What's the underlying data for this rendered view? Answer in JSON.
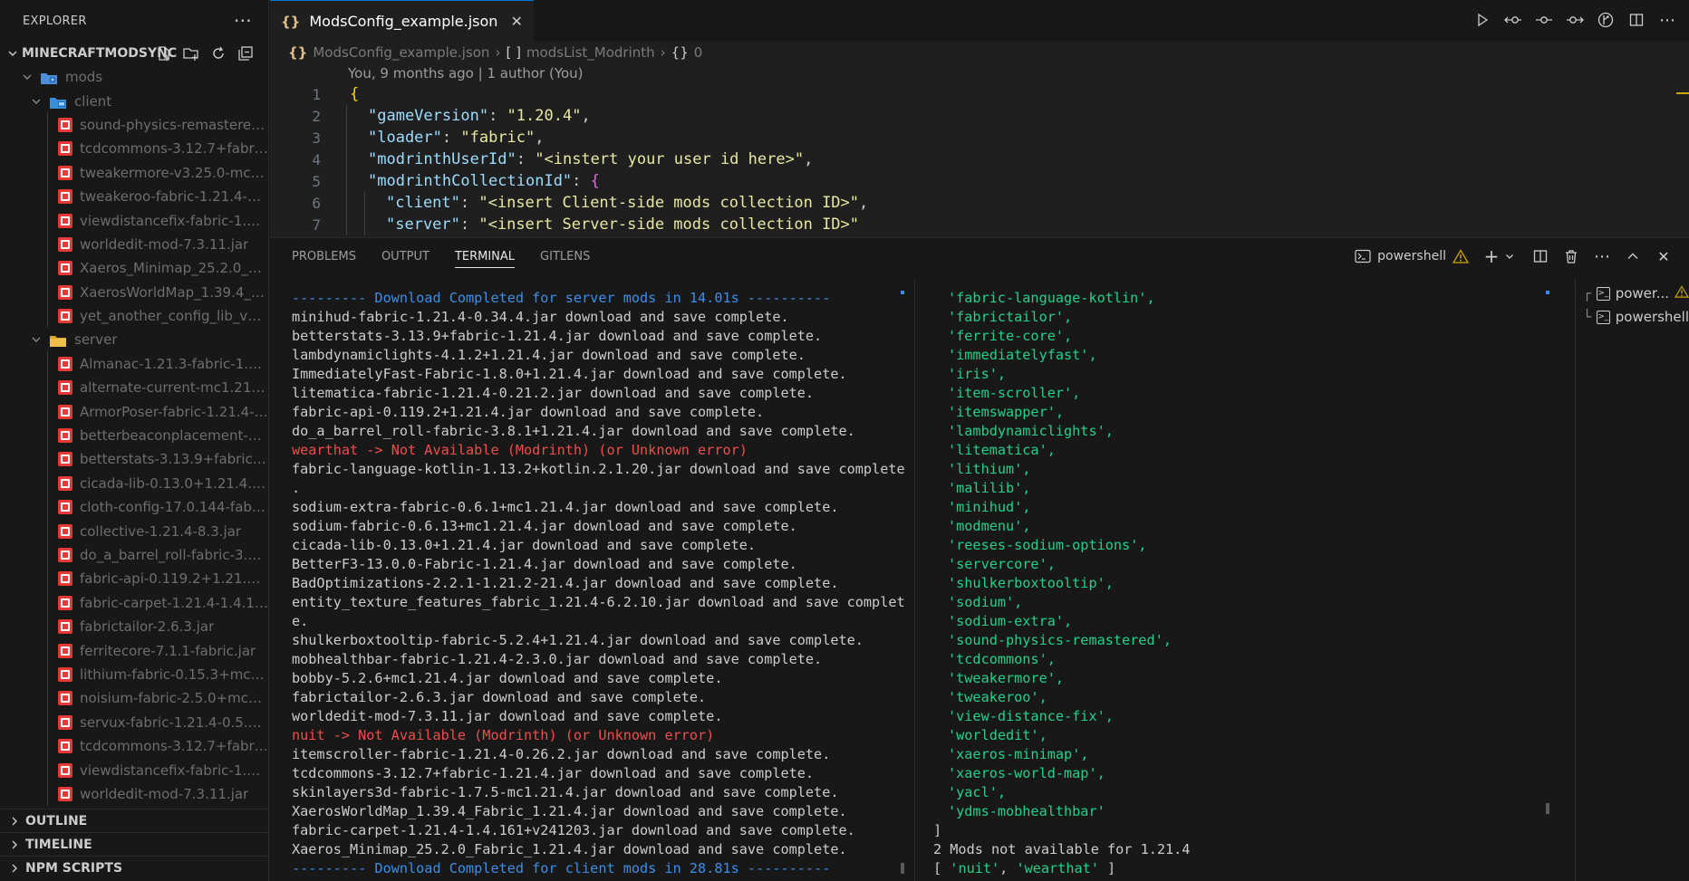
{
  "sidebar": {
    "title": "EXPLORER",
    "root": "MINECRAFTMODSYNC",
    "folder_mods": "mods",
    "folder_client": "client",
    "client_files": [
      "sound-physics-remastered-f...",
      "tcdcommons-3.12.7+fabric-...",
      "tweakermore-v3.25.0-mc1.2...",
      "tweakeroo-fabric-1.21.4-0.2...",
      "viewdistancefix-fabric-1.21.4...",
      "worldedit-mod-7.3.11.jar",
      "Xaeros_Minimap_25.2.0_Fabr...",
      "XaerosWorldMap_1.39.4_Fab...",
      "yet_another_config_lib_v3-3...."
    ],
    "folder_server": "server",
    "server_files": [
      "Almanac-1.21.3-fabric-1.4.4.j...",
      "alternate-current-mc1.21.2-...",
      "ArmorPoser-fabric-1.21.4-8....",
      "betterbeaconplacement-1.2...",
      "betterstats-3.13.9+fabric-1.2...",
      "cicada-lib-0.13.0+1.21.4.jar",
      "cloth-config-17.0.144-fabric...",
      "collective-1.21.4-8.3.jar",
      "do_a_barrel_roll-fabric-3.8.1...",
      "fabric-api-0.119.2+1.21.4.jar",
      "fabric-carpet-1.21.4-1.4.161....",
      "fabrictailor-2.6.3.jar",
      "ferritecore-7.1.1-fabric.jar",
      "lithium-fabric-0.15.3+mc1.2...",
      "noisium-fabric-2.5.0+mc1.21....",
      "servux-fabric-1.21.4-0.5.2.jar",
      "tcdcommons-3.12.7+fabric-...",
      "viewdistancefix-fabric-1.21.4...",
      "worldedit-mod-7.3.11.jar"
    ],
    "sections": [
      "OUTLINE",
      "TIMELINE",
      "NPM SCRIPTS"
    ]
  },
  "editor": {
    "tab_label": "ModsConfig_example.json",
    "tab_icon": "{}",
    "breadcrumb": {
      "file": "ModsConfig_example.json",
      "node1": "modsList_Modrinth",
      "node1_icon": "[ ]",
      "node2": "0",
      "node2_icon": "{}"
    },
    "blame": "You, 9 months ago | 1 author (You)",
    "line_numbers": [
      "1",
      "2",
      "3",
      "4",
      "5",
      "6",
      "7"
    ],
    "code": {
      "l1": "{",
      "l2_key": "\"gameVersion\"",
      "l2_val": "\"1.20.4\"",
      "l3_key": "\"loader\"",
      "l3_val": "\"fabric\"",
      "l4_key": "\"modrinthUserId\"",
      "l4_val": "\"<instert your user id here>\"",
      "l5_key": "\"modrinthCollectionId\"",
      "l5_brace": "{",
      "l6_key": "\"client\"",
      "l6_val": "\"<insert Client-side mods collection ID>\"",
      "l7_key": "\"server\"",
      "l7_val": "\"<insert Server-side mods collection ID>\""
    }
  },
  "panel": {
    "tabs": [
      "PROBLEMS",
      "OUTPUT",
      "TERMINAL",
      "GITLENS"
    ],
    "active_tab": "TERMINAL",
    "shell_label": "powershell",
    "terminal_left": [
      {
        "text": "--------- Download Completed for server mods in 14.01s ----------",
        "color": "blue"
      },
      {
        "text": "minihud-fabric-1.21.4-0.34.4.jar download and save complete.",
        "color": ""
      },
      {
        "text": "betterstats-3.13.9+fabric-1.21.4.jar download and save complete.",
        "color": ""
      },
      {
        "text": "lambdynamiclights-4.1.2+1.21.4.jar download and save complete.",
        "color": ""
      },
      {
        "text": "ImmediatelyFast-Fabric-1.8.0+1.21.4.jar download and save complete.",
        "color": ""
      },
      {
        "text": "litematica-fabric-1.21.4-0.21.2.jar download and save complete.",
        "color": ""
      },
      {
        "text": "fabric-api-0.119.2+1.21.4.jar download and save complete.",
        "color": ""
      },
      {
        "text": "do_a_barrel_roll-fabric-3.8.1+1.21.4.jar download and save complete.",
        "color": ""
      },
      {
        "text": "wearthat -> Not Available (Modrinth) (or Unknown error)",
        "color": "red"
      },
      {
        "text": "fabric-language-kotlin-1.13.2+kotlin.2.1.20.jar download and save complete",
        "color": ""
      },
      {
        "text": ".",
        "color": ""
      },
      {
        "text": "sodium-extra-fabric-0.6.1+mc1.21.4.jar download and save complete.",
        "color": ""
      },
      {
        "text": "sodium-fabric-0.6.13+mc1.21.4.jar download and save complete.",
        "color": ""
      },
      {
        "text": "cicada-lib-0.13.0+1.21.4.jar download and save complete.",
        "color": ""
      },
      {
        "text": "BetterF3-13.0.0-Fabric-1.21.4.jar download and save complete.",
        "color": ""
      },
      {
        "text": "BadOptimizations-2.2.1-1.21.2-21.4.jar download and save complete.",
        "color": ""
      },
      {
        "text": "entity_texture_features_fabric_1.21.4-6.2.10.jar download and save complet",
        "color": ""
      },
      {
        "text": "e.",
        "color": ""
      },
      {
        "text": "shulkerboxtooltip-fabric-5.2.4+1.21.4.jar download and save complete.",
        "color": ""
      },
      {
        "text": "mobhealthbar-fabric-1.21.4-2.3.0.jar download and save complete.",
        "color": ""
      },
      {
        "text": "bobby-5.2.6+mc1.21.4.jar download and save complete.",
        "color": ""
      },
      {
        "text": "fabrictailor-2.6.3.jar download and save complete.",
        "color": ""
      },
      {
        "text": "worldedit-mod-7.3.11.jar download and save complete.",
        "color": ""
      },
      {
        "text": "nuit -> Not Available (Modrinth) (or Unknown error)",
        "color": "red"
      },
      {
        "text": "itemscroller-fabric-1.21.4-0.26.2.jar download and save complete.",
        "color": ""
      },
      {
        "text": "tcdcommons-3.12.7+fabric-1.21.4.jar download and save complete.",
        "color": ""
      },
      {
        "text": "skinlayers3d-fabric-1.7.5-mc1.21.4.jar download and save complete.",
        "color": ""
      },
      {
        "text": "XaerosWorldMap_1.39.4_Fabric_1.21.4.jar download and save complete.",
        "color": ""
      },
      {
        "text": "fabric-carpet-1.21.4-1.4.161+v241203.jar download and save complete.",
        "color": ""
      },
      {
        "text": "Xaeros_Minimap_25.2.0_Fabric_1.21.4.jar download and save complete.",
        "color": ""
      },
      {
        "text": "--------- Download Completed for client mods in 28.81s ----------",
        "color": "blue"
      }
    ],
    "terminal_right": [
      "'fabric-language-kotlin',",
      "'fabrictailor',",
      "'ferrite-core',",
      "'immediatelyfast',",
      "'iris',",
      "'item-scroller',",
      "'itemswapper',",
      "'lambdynamiclights',",
      "'litematica',",
      "'lithium',",
      "'malilib',",
      "'minihud',",
      "'modmenu',",
      "'reeses-sodium-options',",
      "'servercore',",
      "'shulkerboxtooltip',",
      "'sodium',",
      "'sodium-extra',",
      "'sound-physics-remastered',",
      "'tcdcommons',",
      "'tweakermore',",
      "'tweakeroo',",
      "'view-distance-fix',",
      "'worldedit',",
      "'xaeros-minimap',",
      "'xaeros-world-map',",
      "'yacl',",
      "'ydms-mobhealthbar'"
    ],
    "terminal_right_tail": {
      "bracket": "]",
      "summary": "2 Mods not available for 1.21.4",
      "missing_open": "[ ",
      "missing_1": "'nuit'",
      "missing_sep": ", ",
      "missing_2": "'wearthat'",
      "missing_close": " ]"
    },
    "terminals": [
      "power...",
      "powershell"
    ]
  },
  "colors": {
    "accent": "#0078d4",
    "json_key": "#9cdcfe",
    "json_string": "#ce9178",
    "terminal_blue": "#3b8eea",
    "terminal_red": "#f14c4c",
    "terminal_green": "#23d18b",
    "warning": "#cca700"
  }
}
